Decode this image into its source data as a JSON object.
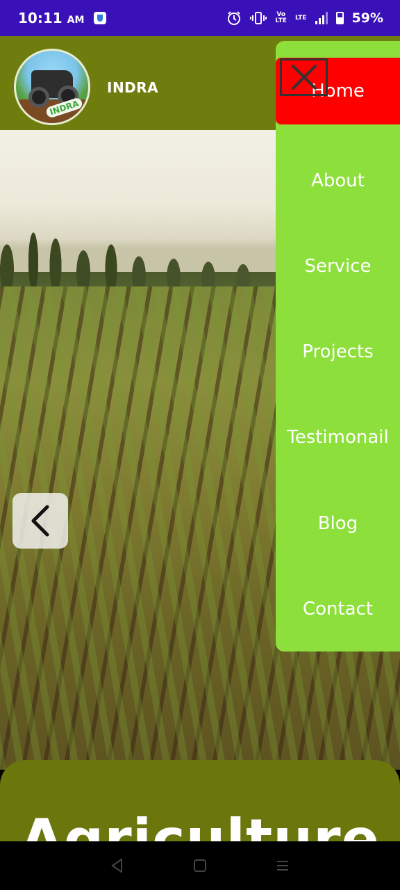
{
  "status_bar": {
    "time": "10:11",
    "ampm": "AM",
    "network": "LTE",
    "battery_percent": "59%"
  },
  "header": {
    "brand": "INDRA",
    "logo_text": "INDRA"
  },
  "side_menu": {
    "items": [
      {
        "label": "Home",
        "active": true
      },
      {
        "label": "About",
        "active": false
      },
      {
        "label": "Service",
        "active": false
      },
      {
        "label": "Projects",
        "active": false
      },
      {
        "label": "Testimonail",
        "active": false
      },
      {
        "label": "Blog",
        "active": false
      },
      {
        "label": "Contact",
        "active": false
      }
    ]
  },
  "banner": {
    "title": "Agriculture"
  },
  "colors": {
    "status_bar": "#3a10b8",
    "header": "#6f7d0f",
    "menu_bg": "#8ddf3b",
    "menu_active": "#ff0000",
    "banner": "#6b760c"
  },
  "icons": [
    "close-icon",
    "chevron-left-icon",
    "alarm-icon",
    "vibrate-icon",
    "back-nav-icon",
    "home-nav-icon",
    "recents-nav-icon"
  ]
}
